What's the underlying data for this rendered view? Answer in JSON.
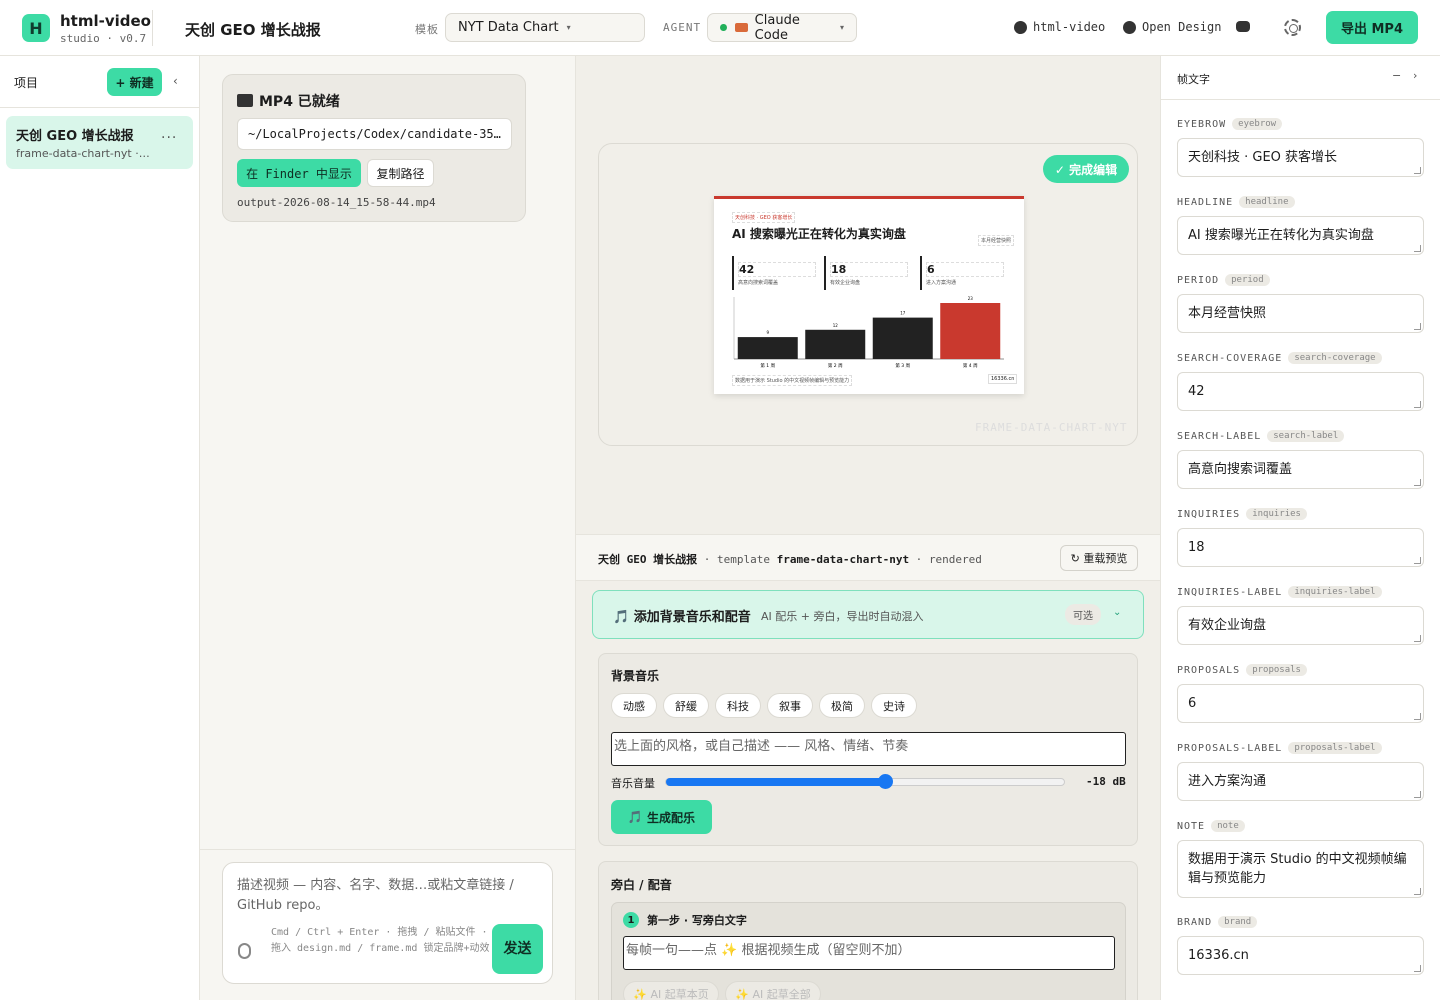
{
  "app": {
    "name": "html-video",
    "version": "studio · v0.7",
    "logo_letter": "H"
  },
  "header": {
    "project_title": "天创 GEO 增长战报",
    "template_label": "模板",
    "template_value": "NYT Data Chart",
    "agent_label": "AGENT",
    "agent_value": "Claude Code",
    "link_html_video": "html-video",
    "link_open_design": "Open Design",
    "export_label": "导出 MP4"
  },
  "sidebar": {
    "title": "项目",
    "new_label": "+ 新建",
    "collapse_icon": "‹",
    "items": [
      {
        "name": "天创 GEO 增长战报",
        "sub": "frame-data-chart-nyt · rendered",
        "more": "···"
      }
    ]
  },
  "chat": {
    "mp4_title": "MP4 已就绪",
    "mp4_path": "~/LocalProjects/Codex/candidate-350…",
    "finder_label": "在 Finder 中显示",
    "copy_label": "复制路径",
    "filename": "output-2026-08-14_15-58-44.mp4",
    "input_placeholder": "描述视频 — 内容、名字、数据…或粘文章链接 / GitHub repo。",
    "input_hint": "Cmd / Ctrl + Enter · 拖拽 / 粘贴文件 · 拖入 design.md / frame.md 锁定品牌+动效",
    "send_label": "发送"
  },
  "preview": {
    "done_label": "✓ 完成编辑",
    "watermark": "FRAME-DATA-CHART-NYT",
    "slide": {
      "eyebrow": "天创科技 · GEO 获客增长",
      "headline": "AI 搜索曝光正在转化为真实询盘",
      "period": "本月经营快照",
      "stats": [
        {
          "value": "42",
          "label": "高意向搜索词覆盖"
        },
        {
          "value": "18",
          "label": "有效企业询盘"
        },
        {
          "value": "6",
          "label": "进入方案沟通"
        }
      ],
      "note": "数据用于演示 Studio 的中文视频帧编辑与预览能力",
      "brand": "16336.cn"
    },
    "chart_data": {
      "type": "bar",
      "categories": [
        "第 1 周",
        "第 2 周",
        "第 3 周",
        "第 4 周"
      ],
      "values": [
        9,
        12,
        17,
        23
      ],
      "highlight_color": "#c9392e",
      "bar_color": "#222222"
    }
  },
  "infobar": {
    "project": "天创 GEO 增长战报",
    "template_prefix": "template",
    "template": "frame-data-chart-nyt",
    "status": "rendered",
    "reload_label": "↻ 重载预览"
  },
  "music": {
    "title": "添加背景音乐和配音",
    "subtitle": "AI 配乐 + 旁白，导出时自动混入",
    "optional_label": "可选",
    "chevron": "⌄",
    "bg_title": "背景音乐",
    "styles": [
      "动感",
      "舒缓",
      "科技",
      "叙事",
      "极简",
      "史诗"
    ],
    "style_placeholder": "选上面的风格，或自己描述 —— 风格、情绪、节奏",
    "volume_label": "音乐音量",
    "volume_db": "-18 dB",
    "volume_fraction": 0.55,
    "generate_label": "生成配乐"
  },
  "narration": {
    "title": "旁白 / 配音",
    "step_num": "1",
    "step_title": "第一步 · 写旁白文字",
    "placeholder": "每帧一句——点 ✨ 根据视频生成（留空则不加）",
    "ai_page": "✨ AI 起草本页",
    "ai_all": "✨ AI 起草全部"
  },
  "fields_panel": {
    "title": "帧文字",
    "minimize": "−",
    "next": "›",
    "fields": [
      {
        "label": "EYEBROW",
        "tag": "eyebrow",
        "value": "天创科技 · GEO 获客增长"
      },
      {
        "label": "HEADLINE",
        "tag": "headline",
        "value": "AI 搜索曝光正在转化为真实询盘"
      },
      {
        "label": "PERIOD",
        "tag": "period",
        "value": "本月经营快照"
      },
      {
        "label": "SEARCH-COVERAGE",
        "tag": "search-coverage",
        "value": "42"
      },
      {
        "label": "SEARCH-LABEL",
        "tag": "search-label",
        "value": "高意向搜索词覆盖"
      },
      {
        "label": "INQUIRIES",
        "tag": "inquiries",
        "value": "18"
      },
      {
        "label": "INQUIRIES-LABEL",
        "tag": "inquiries-label",
        "value": "有效企业询盘"
      },
      {
        "label": "PROPOSALS",
        "tag": "proposals",
        "value": "6"
      },
      {
        "label": "PROPOSALS-LABEL",
        "tag": "proposals-label",
        "value": "进入方案沟通"
      },
      {
        "label": "NOTE",
        "tag": "note",
        "value": "数据用于演示 Studio 的中文视频帧编辑与预览能力"
      },
      {
        "label": "BRAND",
        "tag": "brand",
        "value": "16336.cn"
      }
    ]
  }
}
